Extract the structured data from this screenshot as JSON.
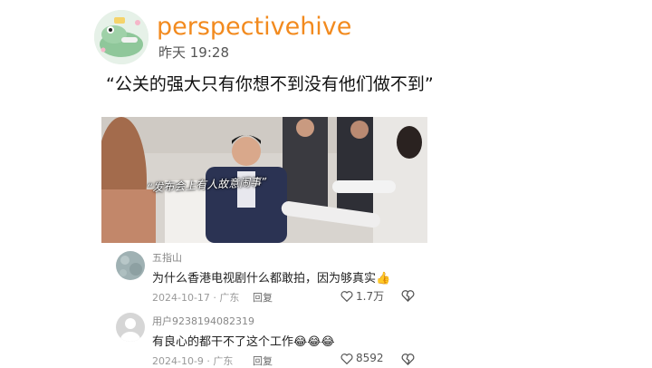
{
  "post": {
    "username": "perspectivehive",
    "timestamp": "昨天 19:28",
    "text": "“公关的强大只有你想不到没有他们做不到”"
  },
  "video": {
    "caption": "“发布会上有人故意闹事”"
  },
  "comments": [
    {
      "name": "五指山",
      "text": "为什么香港电视剧什么都敢拍，因为够真实",
      "emoji": "👍",
      "date": "2024-10-17 · 广东",
      "reply_label": "回复",
      "likes": "1.7万"
    },
    {
      "name": "用户9238194082319",
      "text": "有良心的都干不了这个工作",
      "emoji": "😂😂😂",
      "date": "2024-10-9 · 广东",
      "reply_label": "回复",
      "likes": "8592"
    }
  ],
  "colors": {
    "username": "#f28a1e",
    "meta": "#999999"
  }
}
